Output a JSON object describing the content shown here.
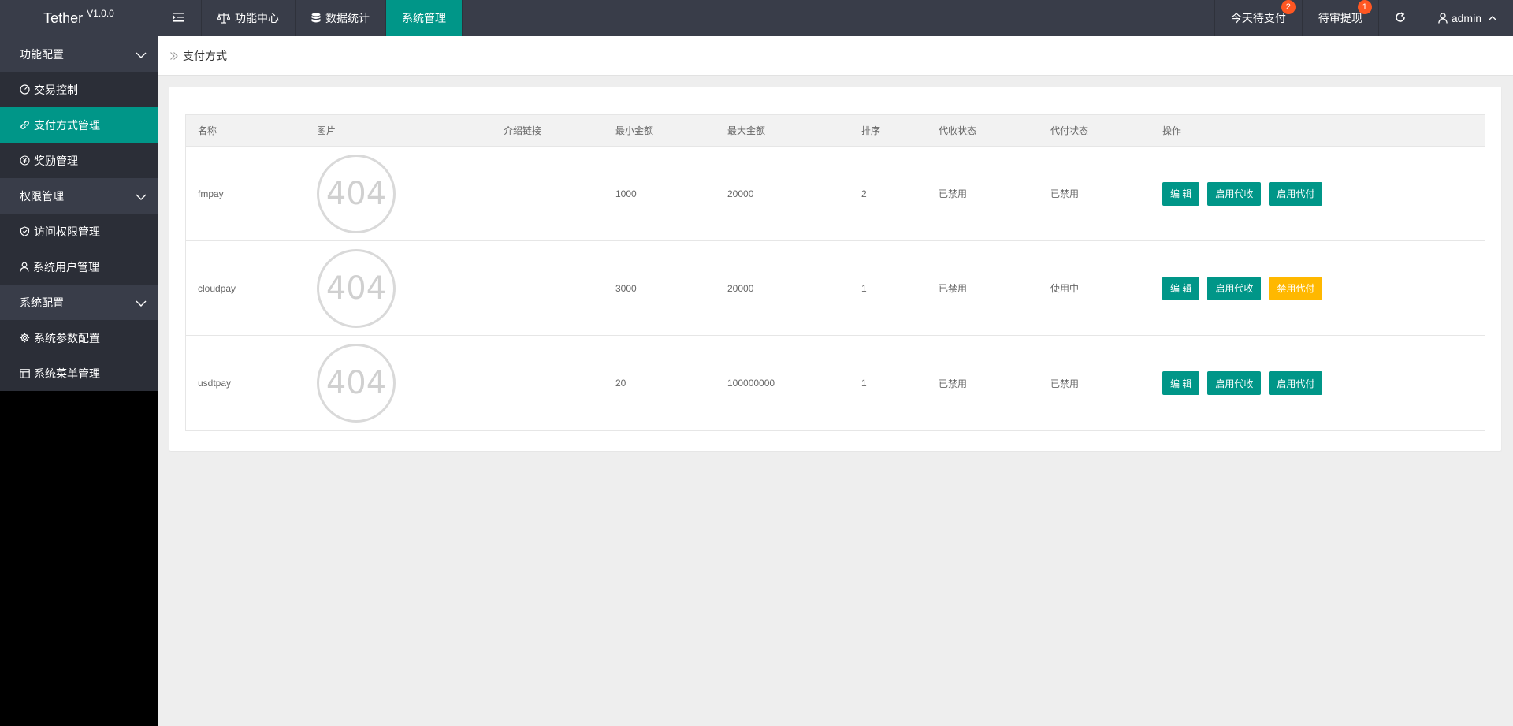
{
  "app": {
    "name": "Tether",
    "version": "V1.0.0"
  },
  "topnav": [
    {
      "label": "功能中心",
      "icon": "scale-icon"
    },
    {
      "label": "数据统计",
      "icon": "database-icon"
    },
    {
      "label": "系统管理",
      "active": true
    }
  ],
  "topright": {
    "pay_today": {
      "label": "今天待支付",
      "badge": "2"
    },
    "withdraw": {
      "label": "待审提现",
      "badge": "1"
    },
    "user": "admin"
  },
  "sidebar": {
    "groups": [
      {
        "label": "功能配置",
        "items": [
          {
            "label": "交易控制",
            "icon": "gauge-icon"
          },
          {
            "label": "支付方式管理",
            "icon": "link-icon",
            "active": true
          },
          {
            "label": "奖励管理",
            "icon": "yen-icon"
          }
        ]
      },
      {
        "label": "权限管理",
        "items": [
          {
            "label": "访问权限管理",
            "icon": "shield-icon"
          },
          {
            "label": "系统用户管理",
            "icon": "user-icon"
          }
        ]
      },
      {
        "label": "系统配置",
        "items": [
          {
            "label": "系统参数配置",
            "icon": "gear-icon"
          },
          {
            "label": "系统菜单管理",
            "icon": "window-icon"
          }
        ]
      }
    ]
  },
  "breadcrumb": "支付方式",
  "table": {
    "headers": [
      "名称",
      "图片",
      "介绍链接",
      "最小金额",
      "最大金额",
      "排序",
      "代收状态",
      "代付状态",
      "操作"
    ],
    "image_placeholder": "404",
    "rows": [
      {
        "name": "fmpay",
        "link": "",
        "min": "1000",
        "max": "20000",
        "sort": "2",
        "collect": "已禁用",
        "pay": "已禁用",
        "collect_on": false,
        "pay_on": false,
        "buttons": [
          "编 辑",
          "启用代收",
          "启用代付"
        ]
      },
      {
        "name": "cloudpay",
        "link": "",
        "min": "3000",
        "max": "20000",
        "sort": "1",
        "collect": "已禁用",
        "pay": "使用中",
        "collect_on": false,
        "pay_on": true,
        "buttons": [
          "编 辑",
          "启用代收",
          "禁用代付"
        ]
      },
      {
        "name": "usdtpay",
        "link": "",
        "min": "20",
        "max": "100000000",
        "sort": "1",
        "collect": "已禁用",
        "pay": "已禁用",
        "collect_on": false,
        "pay_on": false,
        "buttons": [
          "编 辑",
          "启用代收",
          "启用代付"
        ]
      }
    ]
  },
  "colors": {
    "brand": "#009688",
    "header": "#393D49",
    "danger": "#FF5722",
    "success": "#5FB878",
    "warning": "#FFB800"
  }
}
